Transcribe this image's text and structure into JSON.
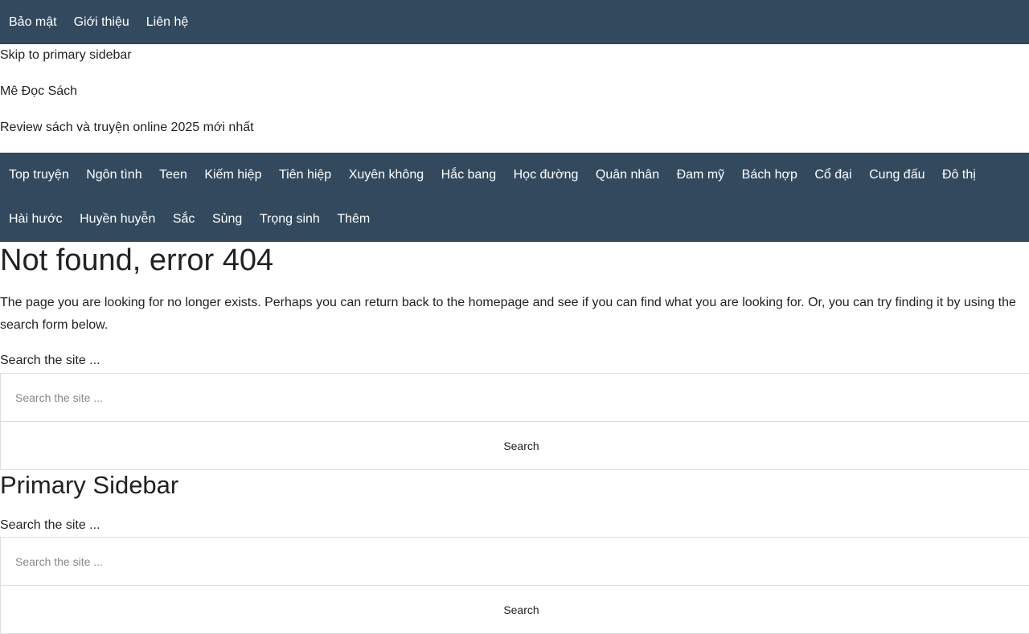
{
  "top_nav": {
    "items": [
      "Bảo mật",
      "Giới thiệu",
      "Liên hệ"
    ]
  },
  "skip_link": "Skip to primary sidebar",
  "site": {
    "title": "Mê Đọc Sách",
    "description": "Review sách và truyện online 2025 mới nhất"
  },
  "main_nav": {
    "row1": [
      "Top truyện",
      "Ngôn tình",
      "Teen",
      "Kiếm hiệp",
      "Tiên hiệp",
      "Xuyên không",
      "Hắc bang",
      "Học đường",
      "Quân nhân",
      "Đam mỹ",
      "Bách hợp",
      "Cổ đại",
      "Cung đấu",
      "Đô thị"
    ],
    "row2": [
      "Hài hước",
      "Huyền huyễn",
      "Sắc",
      "Sủng",
      "Trọng sinh",
      "Thêm"
    ]
  },
  "content": {
    "title": "Not found, error 404",
    "text": "The page you are looking for no longer exists. Perhaps you can return back to the homepage and see if you can find what you are looking for. Or, you can try finding it by using the search form below.",
    "search": {
      "label": "Search the site ...",
      "placeholder": "Search the site ...",
      "button": "Search"
    }
  },
  "sidebar": {
    "title": "Primary Sidebar",
    "search": {
      "label": "Search the site ...",
      "placeholder": "Search the site ...",
      "button": "Search"
    }
  }
}
